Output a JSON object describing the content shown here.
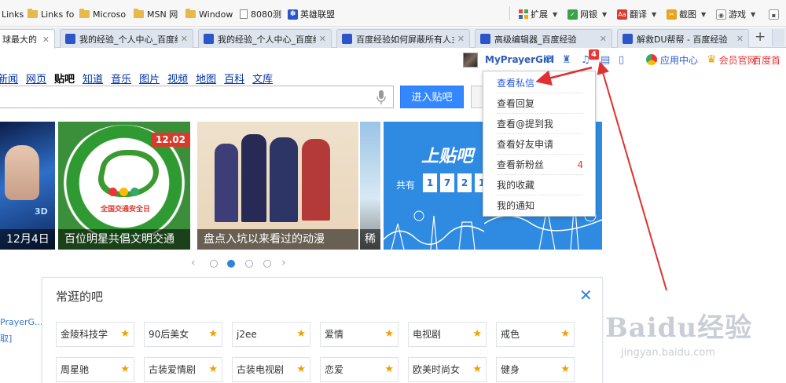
{
  "bookmarks": [
    {
      "label": "Links",
      "icon": "none"
    },
    {
      "label": "Links fo",
      "icon": "folder-icon"
    },
    {
      "label": "Microso",
      "icon": "folder-icon"
    },
    {
      "label": "MSN 网",
      "icon": "folder-icon"
    },
    {
      "label": "Window",
      "icon": "folder-icon"
    },
    {
      "label": "8080测",
      "icon": "document-icon"
    },
    {
      "label": "英雄联盟",
      "icon": "paw-icon"
    }
  ],
  "toolbar": {
    "extensions": "扩展",
    "netbank": "网银",
    "translate": "翻译",
    "screenshot": "截图",
    "games": "游戏"
  },
  "tabs": [
    {
      "title": "球最大的"
    },
    {
      "title": "我的经验_个人中心_百度经"
    },
    {
      "title": "我的经验_个人中心_百度经"
    },
    {
      "title": "百度经验如何屏蔽所有人主"
    },
    {
      "title": "高级编辑器_百度经验"
    },
    {
      "title": "解救DU帮帮 - 百度经验"
    }
  ],
  "user": {
    "name": "MyPrayerGirl",
    "notification_count": "4",
    "app_center": "应用中心",
    "vip": "会员官网",
    "baidu_home": "百度首"
  },
  "search": {
    "nav": [
      "新闻",
      "网页",
      "贴吧",
      "知道",
      "音乐",
      "图片",
      "视频",
      "地图",
      "百科",
      "文库"
    ],
    "current": "贴吧",
    "button": "进入贴吧"
  },
  "banner": {
    "slides": [
      {
        "caption": "12月4日",
        "art": "3D"
      },
      {
        "caption": "百位明星共倡文明交通",
        "date": "12.02",
        "badge": "全国交通安全日"
      },
      {
        "caption": "盘点入坑以来看过的动漫"
      },
      {
        "caption": "稀"
      },
      {
        "caption": "",
        "headline": "上贴吧",
        "prefix": "共有",
        "digits": [
          "1",
          "7",
          "2",
          "1"
        ]
      }
    ],
    "active_dot": 1
  },
  "dropdown": {
    "items": [
      {
        "label": "查看私信",
        "count": ""
      },
      {
        "label": "查看回复",
        "count": ""
      },
      {
        "label": "查看@提到我",
        "count": ""
      },
      {
        "label": "查看好友申请",
        "count": ""
      },
      {
        "label": "查看新粉丝",
        "count": "4"
      },
      {
        "label": "我的收藏",
        "count": ""
      },
      {
        "label": "我的通知",
        "count": ""
      }
    ]
  },
  "forums": {
    "title": "常逛的吧",
    "items": [
      "金陵科技学",
      "90后美女",
      "j2ee",
      "爱情",
      "电视剧",
      "戒色",
      "周星驰",
      "古装爱情剧",
      "古装电视剧",
      "恋爱",
      "欧美时尚女",
      "健身"
    ]
  },
  "left_col": [
    "PrayerG...",
    "取]"
  ],
  "watermark": {
    "brand": "Baidu经验",
    "url": "jingyan.baidu.com"
  },
  "colors": {
    "accent": "#3388ff",
    "link": "#0033aa",
    "alert": "#e33333",
    "arrow": "#e03030"
  }
}
